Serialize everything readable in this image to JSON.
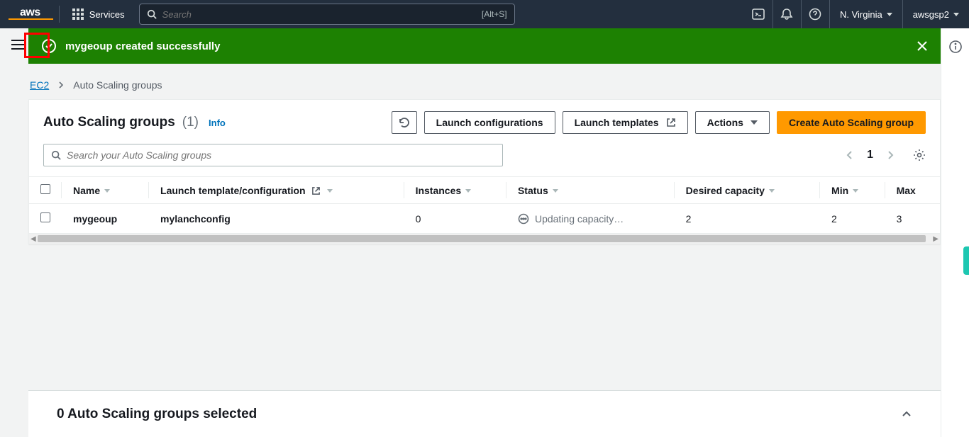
{
  "nav": {
    "logo": "aws",
    "services_label": "Services",
    "search_placeholder": "Search",
    "search_shortcut": "[Alt+S]",
    "region": "N. Virginia",
    "account": "awsgsp2"
  },
  "banner": {
    "message": "mygeoup created successfully"
  },
  "breadcrumbs": {
    "root": "EC2",
    "current": "Auto Scaling groups"
  },
  "panel": {
    "title": "Auto Scaling groups",
    "count": "(1)",
    "info_label": "Info",
    "buttons": {
      "launch_config": "Launch configurations",
      "launch_templates": "Launch templates",
      "actions": "Actions",
      "create": "Create Auto Scaling group"
    },
    "search_placeholder": "Search your Auto Scaling groups",
    "page_num": "1"
  },
  "table": {
    "headers": {
      "name": "Name",
      "launch": "Launch template/configuration",
      "instances": "Instances",
      "status": "Status",
      "desired": "Desired capacity",
      "min": "Min",
      "max": "Max"
    },
    "row": {
      "name": "mygeoup",
      "launch": "mylanchconfig",
      "instances": "0",
      "status": "Updating capacity…",
      "desired": "2",
      "min": "2",
      "max": "3"
    }
  },
  "bottom": {
    "selection_text": "0 Auto Scaling groups selected"
  }
}
